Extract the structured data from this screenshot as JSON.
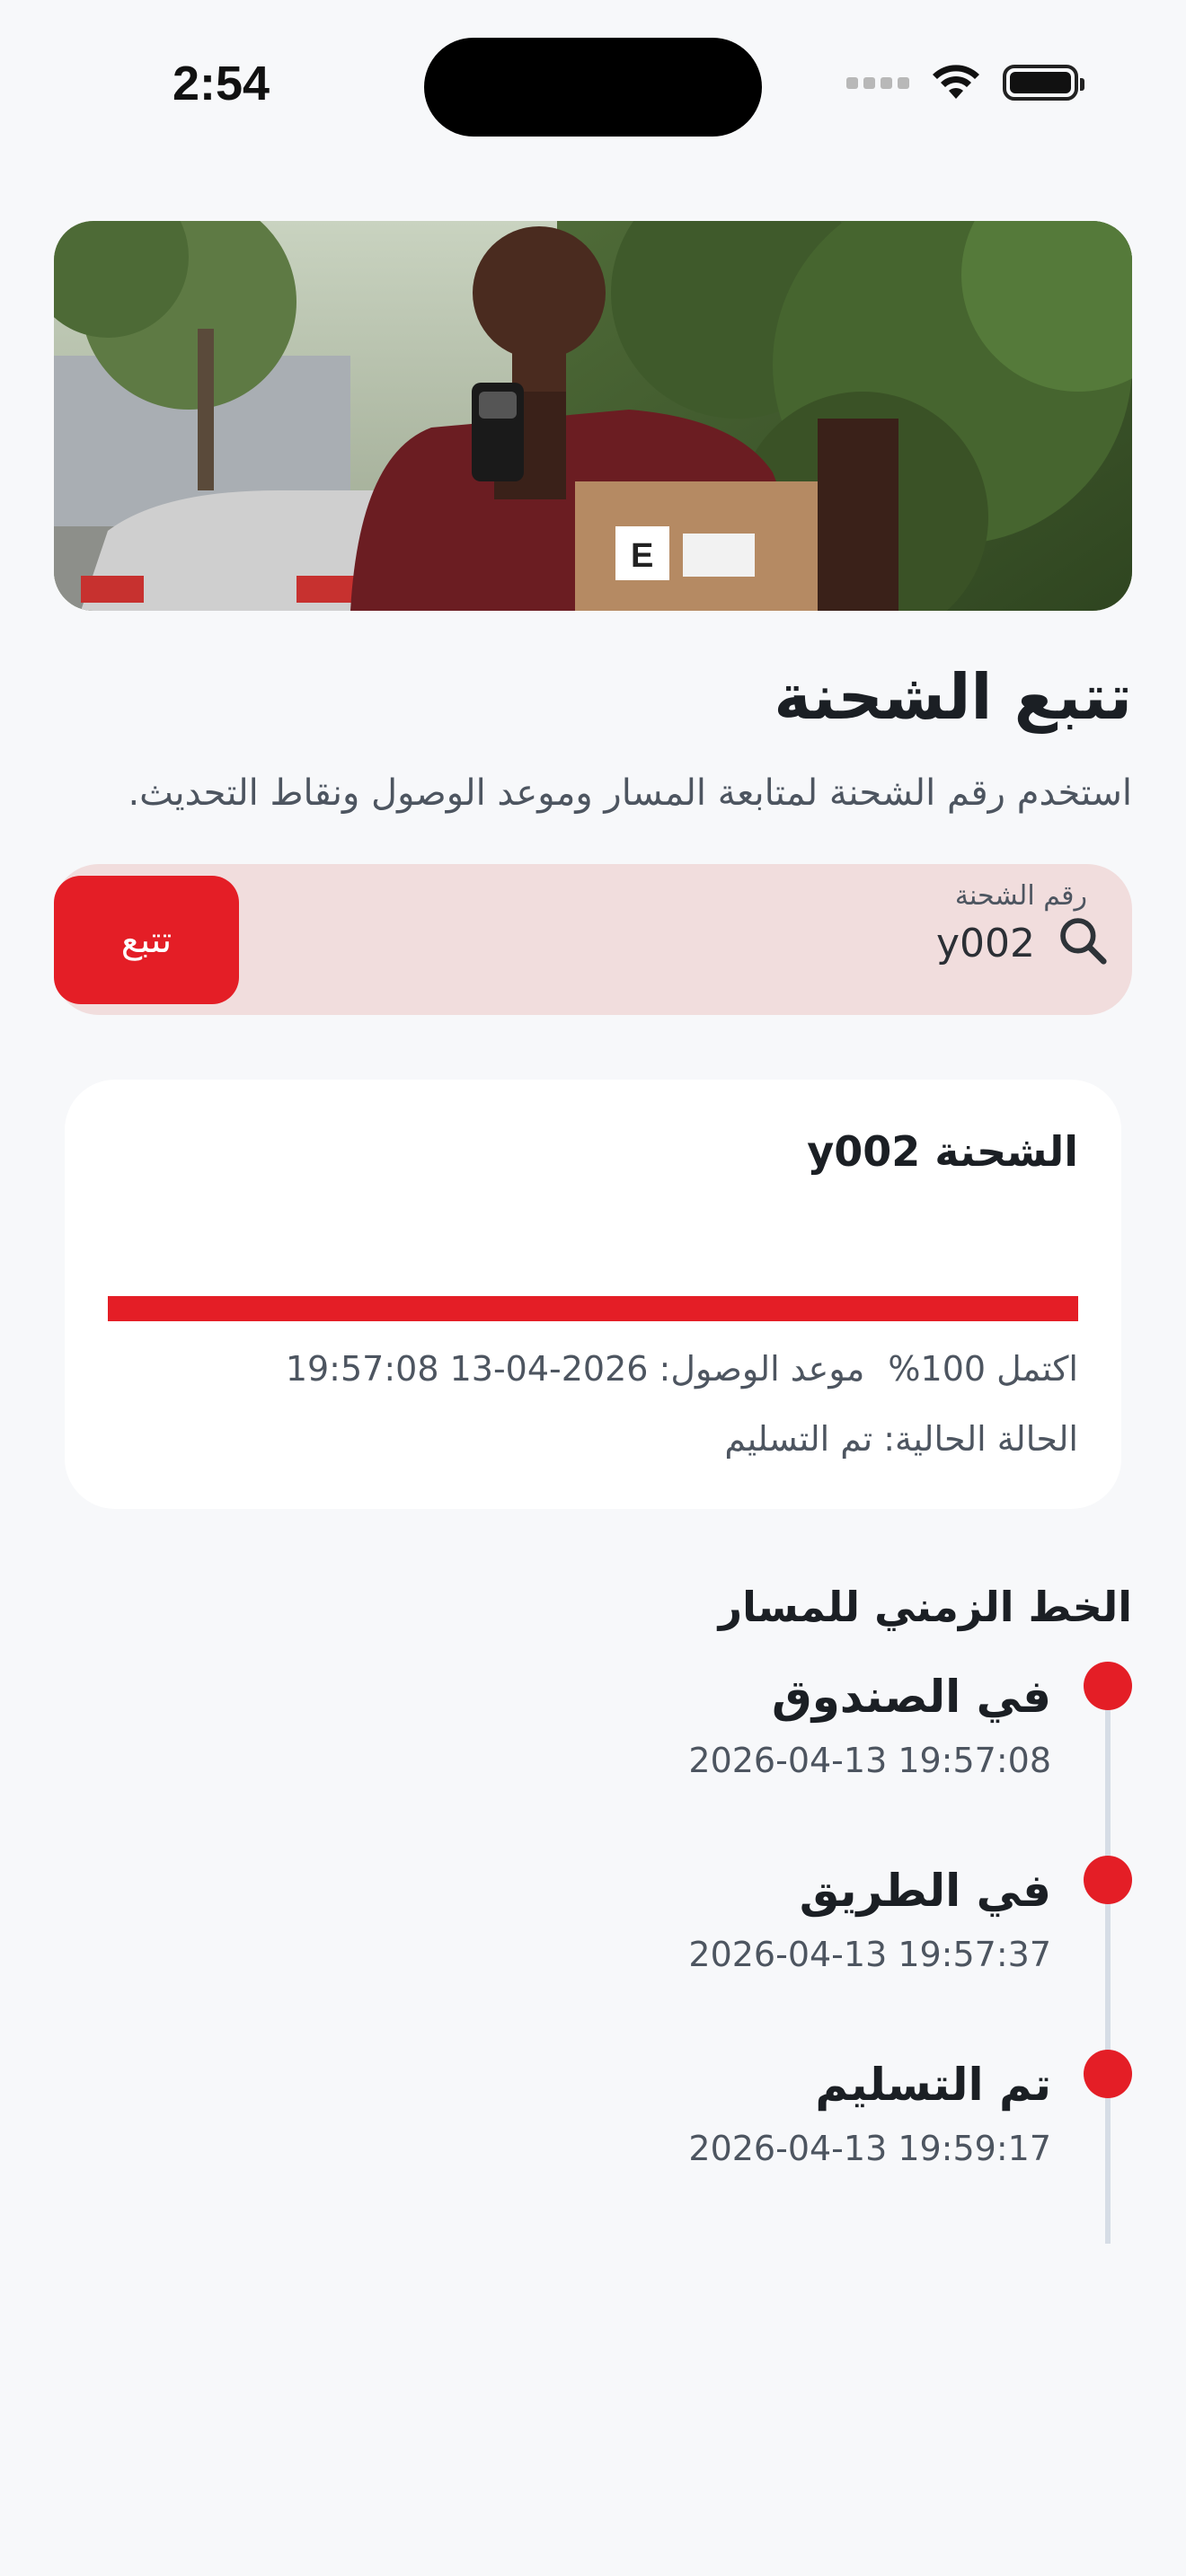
{
  "status_bar": {
    "time": "2:54",
    "battery_level": 1.0
  },
  "hero": {
    "image_label": "delivery person with package"
  },
  "page": {
    "title": "تتبع الشحنة",
    "subtitle": "استخدم رقم الشحنة لمتابعة المسار وموعد الوصول ونقاط التحديث."
  },
  "search": {
    "label": "رقم الشحنة",
    "value": "y002",
    "placeholder": "رقم الشحنة",
    "button_label": "تتبع"
  },
  "shipment": {
    "title": "الشحنة y002",
    "progress_percent": 100,
    "progress_text": "اكتمل 100%",
    "eta_text": "موعد الوصول: 2026-04-13 19:57:08",
    "status_text": "الحالة الحالية: تم التسليم"
  },
  "timeline": {
    "title": "الخط الزمني للمسار",
    "events": [
      {
        "label": "في الصندوق",
        "time": "2026-04-13 19:57:08"
      },
      {
        "label": "في الطريق",
        "time": "2026-04-13 19:57:37"
      },
      {
        "label": "تم التسليم",
        "time": "2026-04-13 19:59:17"
      }
    ]
  },
  "colors": {
    "accent": "#e41e26",
    "search_bg": "#f1dddd",
    "page_bg": "#f7f8fa"
  }
}
